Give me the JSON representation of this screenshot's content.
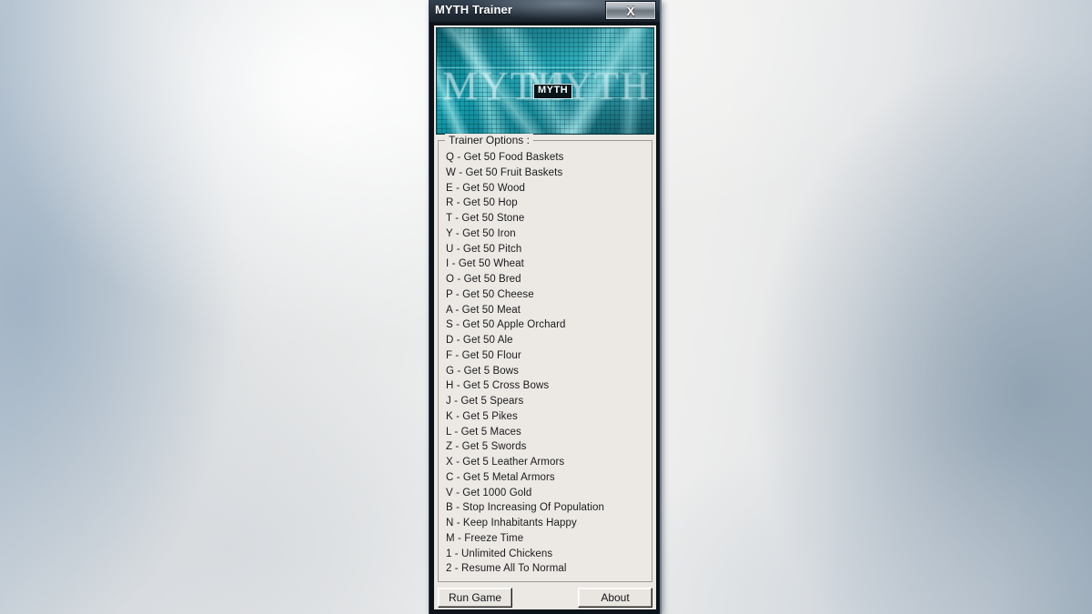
{
  "window": {
    "title": "MYTH Trainer",
    "close_label": "X"
  },
  "banner": {
    "ghost_left": "MYTH",
    "ghost_right": "MYTH",
    "badge": "MYTH"
  },
  "options": {
    "legend": "Trainer Options :",
    "items": [
      "Q - Get 50 Food Baskets",
      "W - Get 50 Fruit Baskets",
      "E - Get 50 Wood",
      "R - Get 50 Hop",
      "T - Get 50 Stone",
      "Y - Get 50 Iron",
      "U - Get 50 Pitch",
      "I - Get 50 Wheat",
      "O - Get 50 Bred",
      "P - Get 50 Cheese",
      "A - Get 50 Meat",
      "S - Get 50 Apple Orchard",
      "D - Get 50 Ale",
      "F - Get 50 Flour",
      "G - Get 5 Bows",
      "H - Get 5 Cross Bows",
      "J - Get 5 Spears",
      "K - Get 5 Pikes",
      "L - Get 5 Maces",
      "Z - Get 5 Swords",
      "X - Get 5 Leather Armors",
      "C - Get 5 Metal Armors",
      "V - Get 1000 Gold",
      "B - Stop Increasing Of Population",
      "N - Keep Inhabitants Happy",
      "M - Freeze Time",
      "1 - Unlimited Chickens",
      "2 - Resume All To Normal"
    ]
  },
  "footer": {
    "run_game_label": "Run Game",
    "about_label": "About"
  },
  "colors": {
    "titlebar": "#2b3744",
    "banner_teal": "#1aa6b6",
    "client_bg": "#ece9e4",
    "text": "#1a1a1d"
  }
}
